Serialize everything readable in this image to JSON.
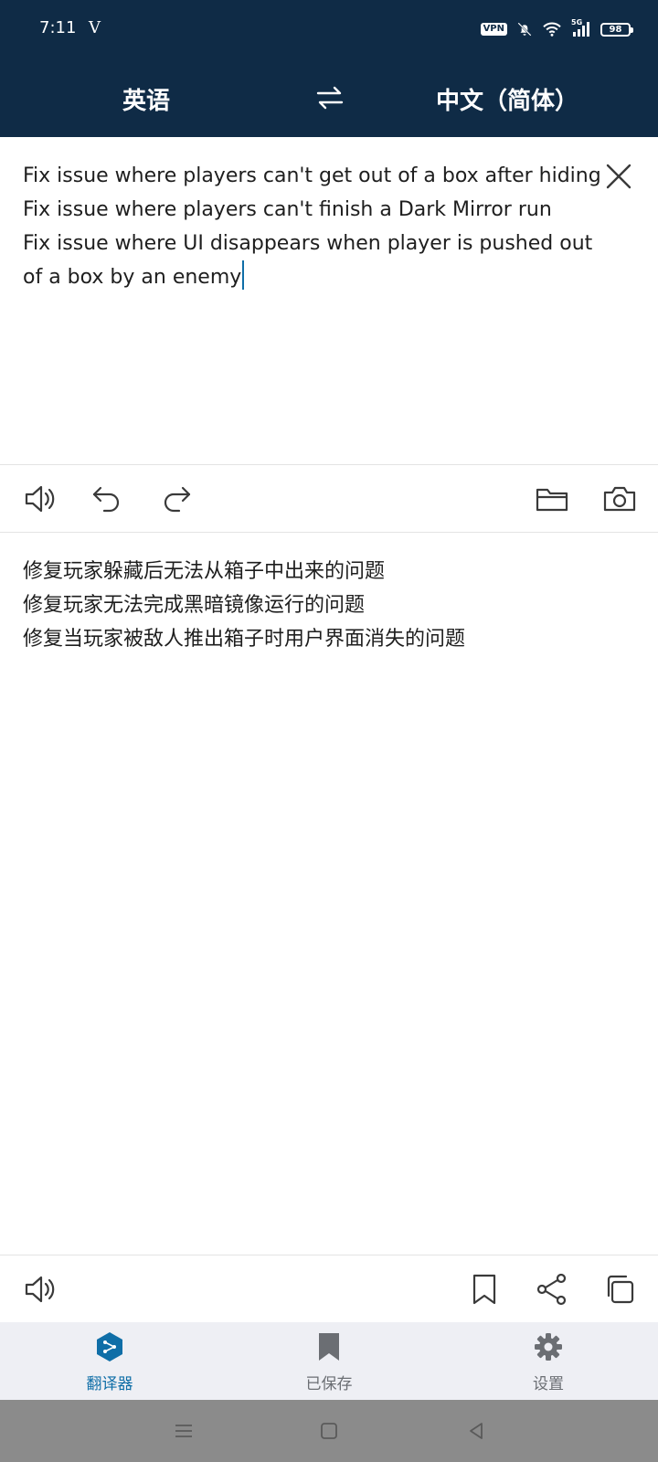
{
  "status_bar": {
    "time": "7:11",
    "carrier_icon_label": "V",
    "vpn_label": "VPN",
    "network_label": "5G",
    "battery_level": "98",
    "icons": [
      "vpn-icon",
      "mute-bell-icon",
      "wifi-icon",
      "signal-icon",
      "battery-icon"
    ]
  },
  "languages": {
    "source": "英语",
    "target": "中文（简体）",
    "swap_icon": "swap-arrows-icon"
  },
  "source": {
    "lines": [
      "Fix issue where players can't get out of a box after hiding",
      "Fix issue where players can't finish a Dark Mirror run",
      "Fix issue where UI disappears when player is pushed out",
      "of a box by an enemy"
    ],
    "clear_icon": "close-icon"
  },
  "source_toolbar": {
    "icons": [
      "speaker-icon",
      "undo-icon",
      "redo-icon",
      "folder-icon",
      "camera-icon"
    ]
  },
  "translation": {
    "lines": [
      "修复玩家躲藏后无法从箱子中出来的问题",
      "修复玩家无法完成黑暗镜像运行的问题",
      "修复当玩家被敌人推出箱子时用户界面消失的问题"
    ]
  },
  "target_toolbar": {
    "icons": [
      "speaker-icon",
      "bookmark-icon",
      "share-icon",
      "copy-icon"
    ]
  },
  "bottom_nav": {
    "items": [
      {
        "label": "翻译器",
        "icon": "translator-icon",
        "active": true
      },
      {
        "label": "已保存",
        "icon": "bookmark-icon",
        "active": false
      },
      {
        "label": "设置",
        "icon": "gear-icon",
        "active": false
      }
    ]
  },
  "colors": {
    "header_bg": "#0f2b46",
    "accent": "#0f6ea7",
    "nav_bg": "#eeeff4",
    "system_nav_bg": "#8b8b8b"
  }
}
